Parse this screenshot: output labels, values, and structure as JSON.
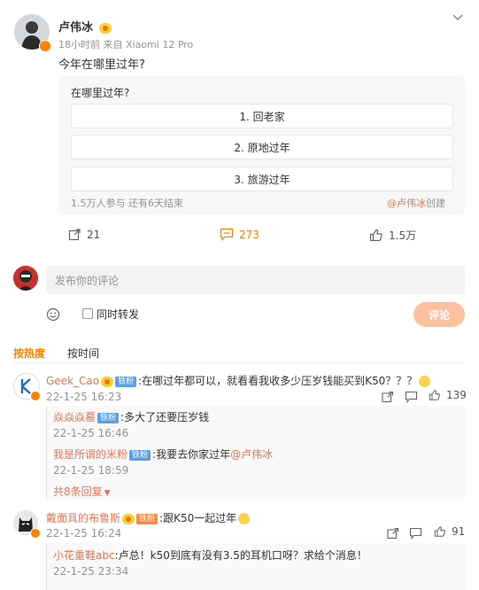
{
  "post": {
    "author": "卢伟冰",
    "time": "18小时前",
    "source": "来自 Xiaomi 12 Pro",
    "text": "今年在哪里过年?"
  },
  "poll": {
    "question": "在哪里过年?",
    "options": [
      "1. 回老家",
      "2. 原地过年",
      "3. 旅游过年"
    ],
    "stats": "1.5万人参与 还有6天结束",
    "creator": "@卢伟冰",
    "creator_suffix": "创建"
  },
  "actions": {
    "share_count": "21",
    "comment_count": "273",
    "like_count": "1.5万"
  },
  "composer": {
    "placeholder": "发布你的评论",
    "repost_label": "同时转发",
    "submit_label": "评论"
  },
  "sort_tabs": [
    "按热度",
    "按时间"
  ],
  "comments": [
    {
      "user": "Geek_Cao",
      "badge": "铁粉",
      "text": ":在哪过年都可以，就看看我收多少压岁钱能买到K50？？？",
      "date": "22-1-25 16:23",
      "likes": "139",
      "replies": [
        {
          "user": "焱焱焱墓",
          "badge": "铁粉",
          "text": ":多大了还要压岁钱",
          "date": "22-1-25 16:46"
        },
        {
          "user": "我是所谓的米粉",
          "badge": "铁粉",
          "text": ":我要去你家过年",
          "mention": "@卢伟冰",
          "date": "22-1-25 18:59"
        }
      ],
      "more_replies": "共8条回复"
    },
    {
      "user": "戴面具的布鲁斯",
      "badge": "铁粉",
      "text": ":跟K50一起过年",
      "date": "22-1-25 16:24",
      "likes": "91",
      "replies": [
        {
          "user": "小花重鞋abc",
          "text": ":卢总！k50到底有没有3.5的耳机口呀？求给个消息！",
          "date": "22-1-25 23:34"
        }
      ]
    }
  ],
  "colors": {
    "accent": "#ff8200",
    "link": "#eb7350",
    "submit_bg": "#ffc09f"
  }
}
